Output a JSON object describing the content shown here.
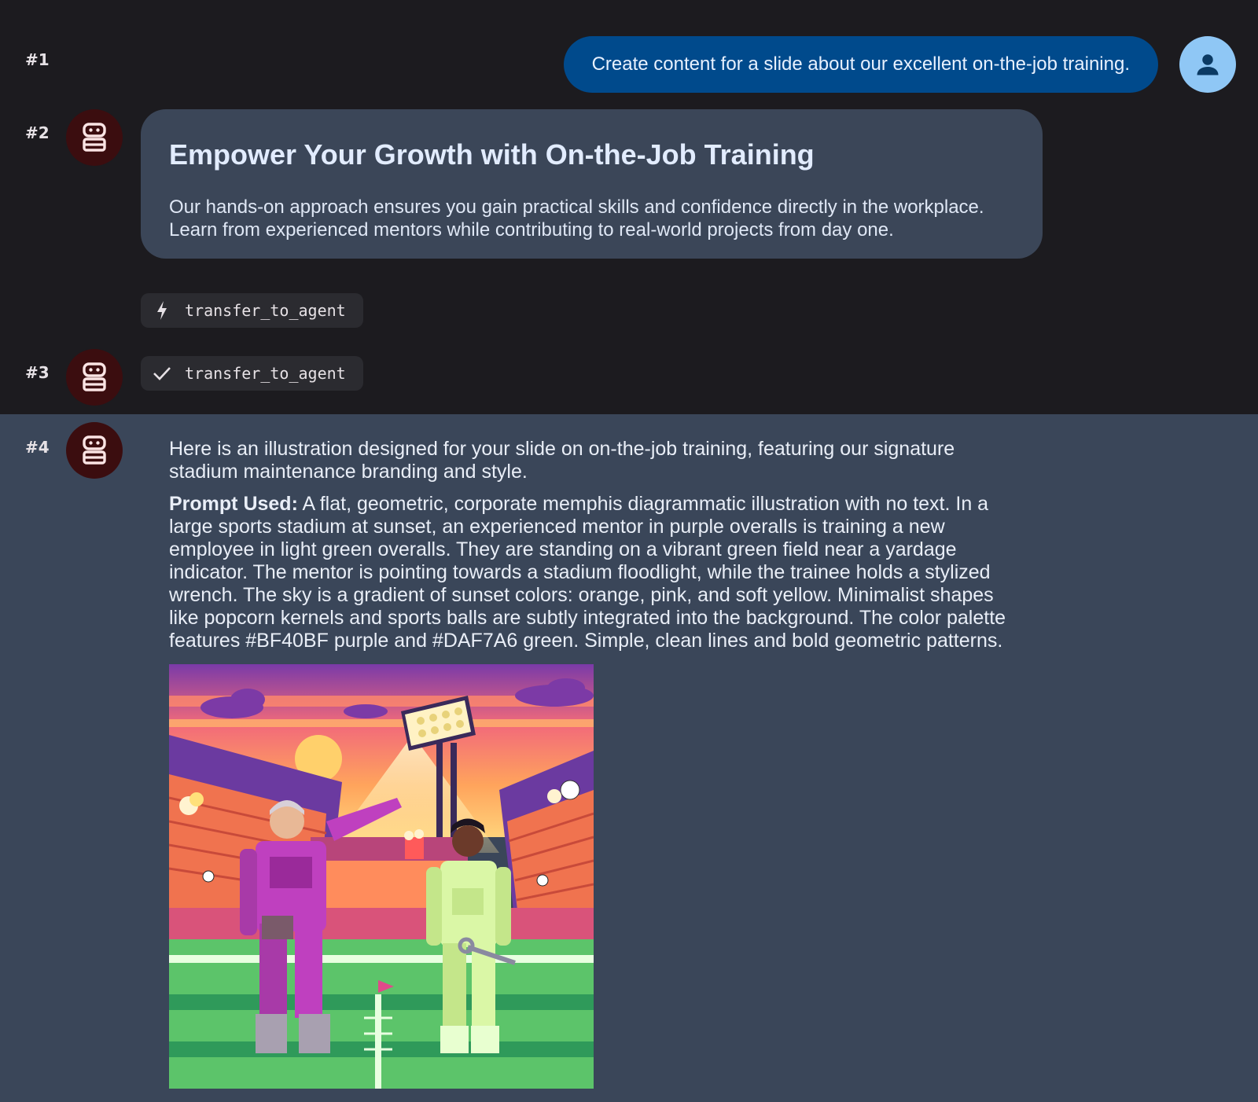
{
  "messages": [
    {
      "index": "#1",
      "role": "user",
      "text": "Create content for a slide about our excellent on-the-job training."
    },
    {
      "index": "#2",
      "role": "agent",
      "title": "Empower Your Growth with On-the-Job Training",
      "body": "Our hands-on approach ensures you gain practical skills and confidence directly in the workplace. Learn from experienced mentors while contributing to real-world projects from day one.",
      "tool_call": {
        "icon": "lightning-icon",
        "name": "transfer_to_agent"
      }
    },
    {
      "index": "#3",
      "role": "agent",
      "tool_result": {
        "icon": "check-icon",
        "name": "transfer_to_agent"
      }
    },
    {
      "index": "#4",
      "role": "agent",
      "intro": "Here is an illustration designed for your slide on on-the-job training, featuring our signature stadium maintenance branding and style.",
      "prompt_label": "Prompt Used:",
      "prompt_text": "A flat, geometric, corporate memphis diagrammatic illustration with no text. In a large sports stadium at sunset, an experienced mentor in purple overalls is training a new employee in light green overalls. They are standing on a vibrant green field near a yardage indicator. The mentor is pointing towards a stadium floodlight, while the trainee holds a stylized wrench. The sky is a gradient of sunset colors: orange, pink, and soft yellow. Minimalist shapes like popcorn kernels and sports balls are subtly integrated into the background. The color palette features #BF40BF purple and #DAF7A6 green. Simple, clean lines and bold geometric patterns.",
      "image": {
        "name": "stadium-training-illustration"
      }
    }
  ],
  "colors": {
    "page_bg": "#1c1b1f",
    "user_bubble": "#004a8c",
    "agent_bubble": "#3b4658",
    "highlight_row": "#3a4659",
    "bot_avatar": "#3b0d0f",
    "user_avatar": "#8fc7f5",
    "mentor_purple": "#BF40BF",
    "trainee_green": "#DAF7A6"
  }
}
